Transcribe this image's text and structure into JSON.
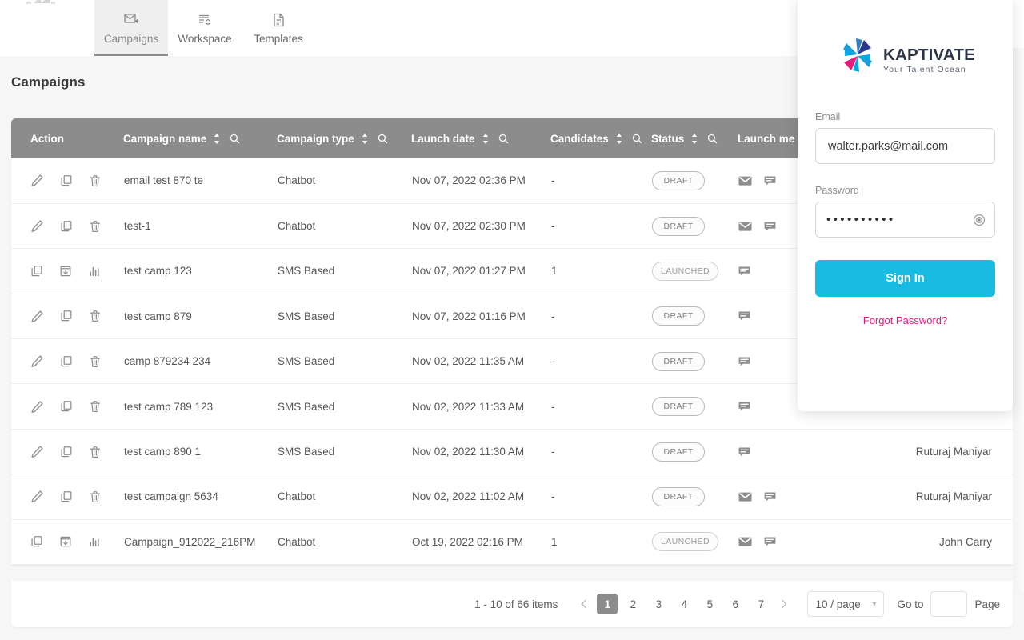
{
  "topnav": {
    "brand_icon": "kaptivate-mark-icon",
    "tabs": [
      {
        "label": "Campaigns",
        "icon": "campaign-envelope-icon",
        "active": true
      },
      {
        "label": "Workspace",
        "icon": "workspace-list-gear-icon",
        "active": false
      },
      {
        "label": "Templates",
        "icon": "template-document-icon",
        "active": false
      }
    ]
  },
  "page": {
    "title": "Campaigns"
  },
  "table": {
    "columns": [
      {
        "label": "Action",
        "sortable": false,
        "searchable": false
      },
      {
        "label": "Campaign name",
        "sortable": true,
        "searchable": true
      },
      {
        "label": "Campaign type",
        "sortable": true,
        "searchable": true
      },
      {
        "label": "Launch date",
        "sortable": true,
        "searchable": true
      },
      {
        "label": "Candidates",
        "sortable": true,
        "searchable": true
      },
      {
        "label": "Status",
        "sortable": true,
        "searchable": true
      },
      {
        "label": "Launch me",
        "sortable": false,
        "searchable": false
      },
      {
        "label": "",
        "sortable": false,
        "searchable": false
      }
    ],
    "rows": [
      {
        "actions": [
          "edit-icon",
          "copy-icon",
          "delete-icon"
        ],
        "name": "email test 870 te",
        "type": "Chatbot",
        "launch_date": "Nov 07, 2022 02:36 PM",
        "candidates": "-",
        "status": "DRAFT",
        "media": [
          "email-icon",
          "chat-icon"
        ],
        "created_by": ""
      },
      {
        "actions": [
          "edit-icon",
          "copy-icon",
          "delete-icon"
        ],
        "name": "test-1",
        "type": "Chatbot",
        "launch_date": "Nov 07, 2022 02:30 PM",
        "candidates": "-",
        "status": "DRAFT",
        "media": [
          "email-icon",
          "chat-icon"
        ],
        "created_by": ""
      },
      {
        "actions": [
          "copy-icon",
          "export-icon",
          "report-icon"
        ],
        "name": "test camp 123",
        "type": "SMS Based",
        "launch_date": "Nov 07, 2022 01:27 PM",
        "candidates": "1",
        "status": "LAUNCHED",
        "media": [
          "chat-icon"
        ],
        "created_by": ""
      },
      {
        "actions": [
          "edit-icon",
          "copy-icon",
          "delete-icon"
        ],
        "name": "test camp 879",
        "type": "SMS Based",
        "launch_date": "Nov 07, 2022 01:16 PM",
        "candidates": "-",
        "status": "DRAFT",
        "media": [
          "chat-icon"
        ],
        "created_by": ""
      },
      {
        "actions": [
          "edit-icon",
          "copy-icon",
          "delete-icon"
        ],
        "name": "camp 879234 234",
        "type": "SMS Based",
        "launch_date": "Nov 02, 2022 11:35 AM",
        "candidates": "-",
        "status": "DRAFT",
        "media": [
          "chat-icon"
        ],
        "created_by": ""
      },
      {
        "actions": [
          "edit-icon",
          "copy-icon",
          "delete-icon"
        ],
        "name": "test camp 789 123",
        "type": "SMS Based",
        "launch_date": "Nov 02, 2022 11:33 AM",
        "candidates": "-",
        "status": "DRAFT",
        "media": [
          "chat-icon"
        ],
        "created_by": ""
      },
      {
        "actions": [
          "edit-icon",
          "copy-icon",
          "delete-icon"
        ],
        "name": "test camp 890 1",
        "type": "SMS Based",
        "launch_date": "Nov 02, 2022 11:30 AM",
        "candidates": "-",
        "status": "DRAFT",
        "media": [
          "chat-icon"
        ],
        "created_by": "Ruturaj Maniyar"
      },
      {
        "actions": [
          "edit-icon",
          "copy-icon",
          "delete-icon"
        ],
        "name": "test campaign 5634",
        "type": "Chatbot",
        "launch_date": "Nov 02, 2022 11:02 AM",
        "candidates": "-",
        "status": "DRAFT",
        "media": [
          "email-icon",
          "chat-icon"
        ],
        "created_by": "Ruturaj Maniyar"
      },
      {
        "actions": [
          "copy-icon",
          "export-icon",
          "report-icon"
        ],
        "name": "Campaign_912022_216PM",
        "type": "Chatbot",
        "launch_date": "Oct 19, 2022 02:16 PM",
        "candidates": "1",
        "status": "LAUNCHED",
        "media": [
          "email-icon",
          "chat-icon"
        ],
        "created_by": "John Carry"
      }
    ]
  },
  "pagination": {
    "summary": "1 - 10 of 66 items",
    "prev_icon": "chevron-left-icon",
    "next_icon": "chevron-right-icon",
    "pages": [
      "1",
      "2",
      "3",
      "4",
      "5",
      "6",
      "7"
    ],
    "current_page": "1",
    "page_size": "10 / page",
    "goto_label": "Go to",
    "goto_value": "",
    "page_label": "Page"
  },
  "login": {
    "logo": {
      "name": "KAPTIVATE",
      "tagline": "Your Talent Ocean",
      "icon": "kaptivate-pinwheel-icon",
      "colors": {
        "blade_top_left": "#1b9dd9",
        "blade_top_right": "#2d3a8c",
        "blade_bottom_left": "#e8197d",
        "blade_bottom_right": "#00a9e0",
        "wordmark": "#2d3548"
      }
    },
    "email_label": "Email",
    "email_value": "walter.parks@mail.com",
    "email_placeholder": "Email",
    "password_label": "Password",
    "password_value": "••••••••••",
    "password_placeholder": "Password",
    "toggle_password_icon": "eye-icon",
    "signin_label": "Sign In",
    "forgot_label": "Forgot Password?",
    "colors": {
      "primary": "#19bbe3",
      "link": "#e8197d"
    }
  }
}
